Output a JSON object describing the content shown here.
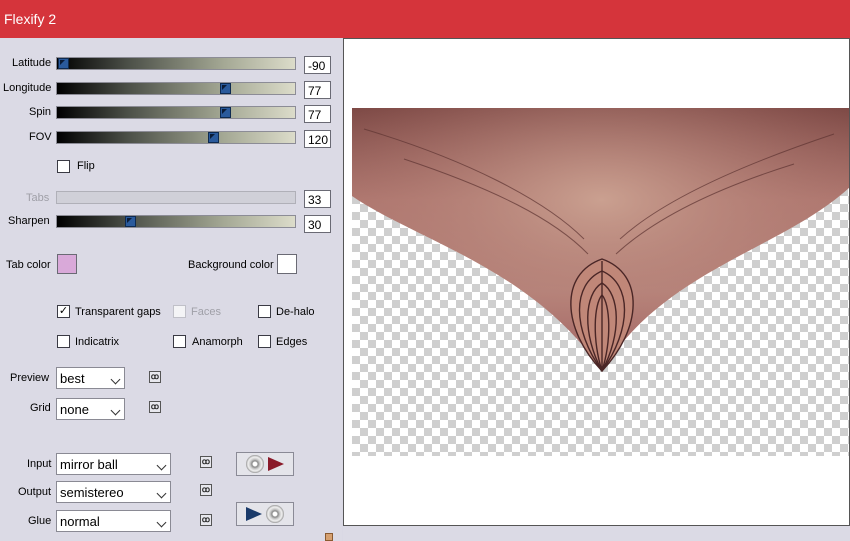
{
  "window": {
    "title": "Flexify 2"
  },
  "sliders": [
    {
      "label": "Latitude",
      "value": "-90",
      "fraction": 0.0,
      "enabled": true
    },
    {
      "label": "Longitude",
      "value": "77",
      "fraction": 0.714,
      "enabled": true
    },
    {
      "label": "Spin",
      "value": "77",
      "fraction": 0.714,
      "enabled": true
    },
    {
      "label": "FOV",
      "value": "120",
      "fraction": 0.667,
      "enabled": true
    },
    {
      "label": "Tabs",
      "value": "33",
      "fraction": 0.33,
      "enabled": false
    },
    {
      "label": "Sharpen",
      "value": "30",
      "fraction": 0.3,
      "enabled": true
    }
  ],
  "flip": {
    "label": "Flip",
    "checked": false
  },
  "colors": {
    "tab_color_label": "Tab color",
    "tab_color": "#d9a9d9",
    "background_color_label": "Background color",
    "background_color": "#ffffff"
  },
  "options": {
    "transparent_gaps": {
      "label": "Transparent gaps",
      "checked": true
    },
    "faces": {
      "label": "Faces",
      "checked": false,
      "enabled": false
    },
    "de_halo": {
      "label": "De-halo",
      "checked": false
    },
    "indicatrix": {
      "label": "Indicatrix",
      "checked": false
    },
    "anamorph": {
      "label": "Anamorph",
      "checked": false
    },
    "edges": {
      "label": "Edges",
      "checked": false
    }
  },
  "preview_select": {
    "label": "Preview",
    "value": "best"
  },
  "grid_select": {
    "label": "Grid",
    "value": "none"
  },
  "input_select": {
    "label": "Input",
    "value": "mirror ball"
  },
  "output_select": {
    "label": "Output",
    "value": "semistereo"
  },
  "glue_select": {
    "label": "Glue",
    "value": "normal"
  },
  "icons": {
    "link": "link-icon",
    "convert_forward": "disc-to-arrow-icon",
    "convert_back": "arrow-to-disc-icon"
  }
}
